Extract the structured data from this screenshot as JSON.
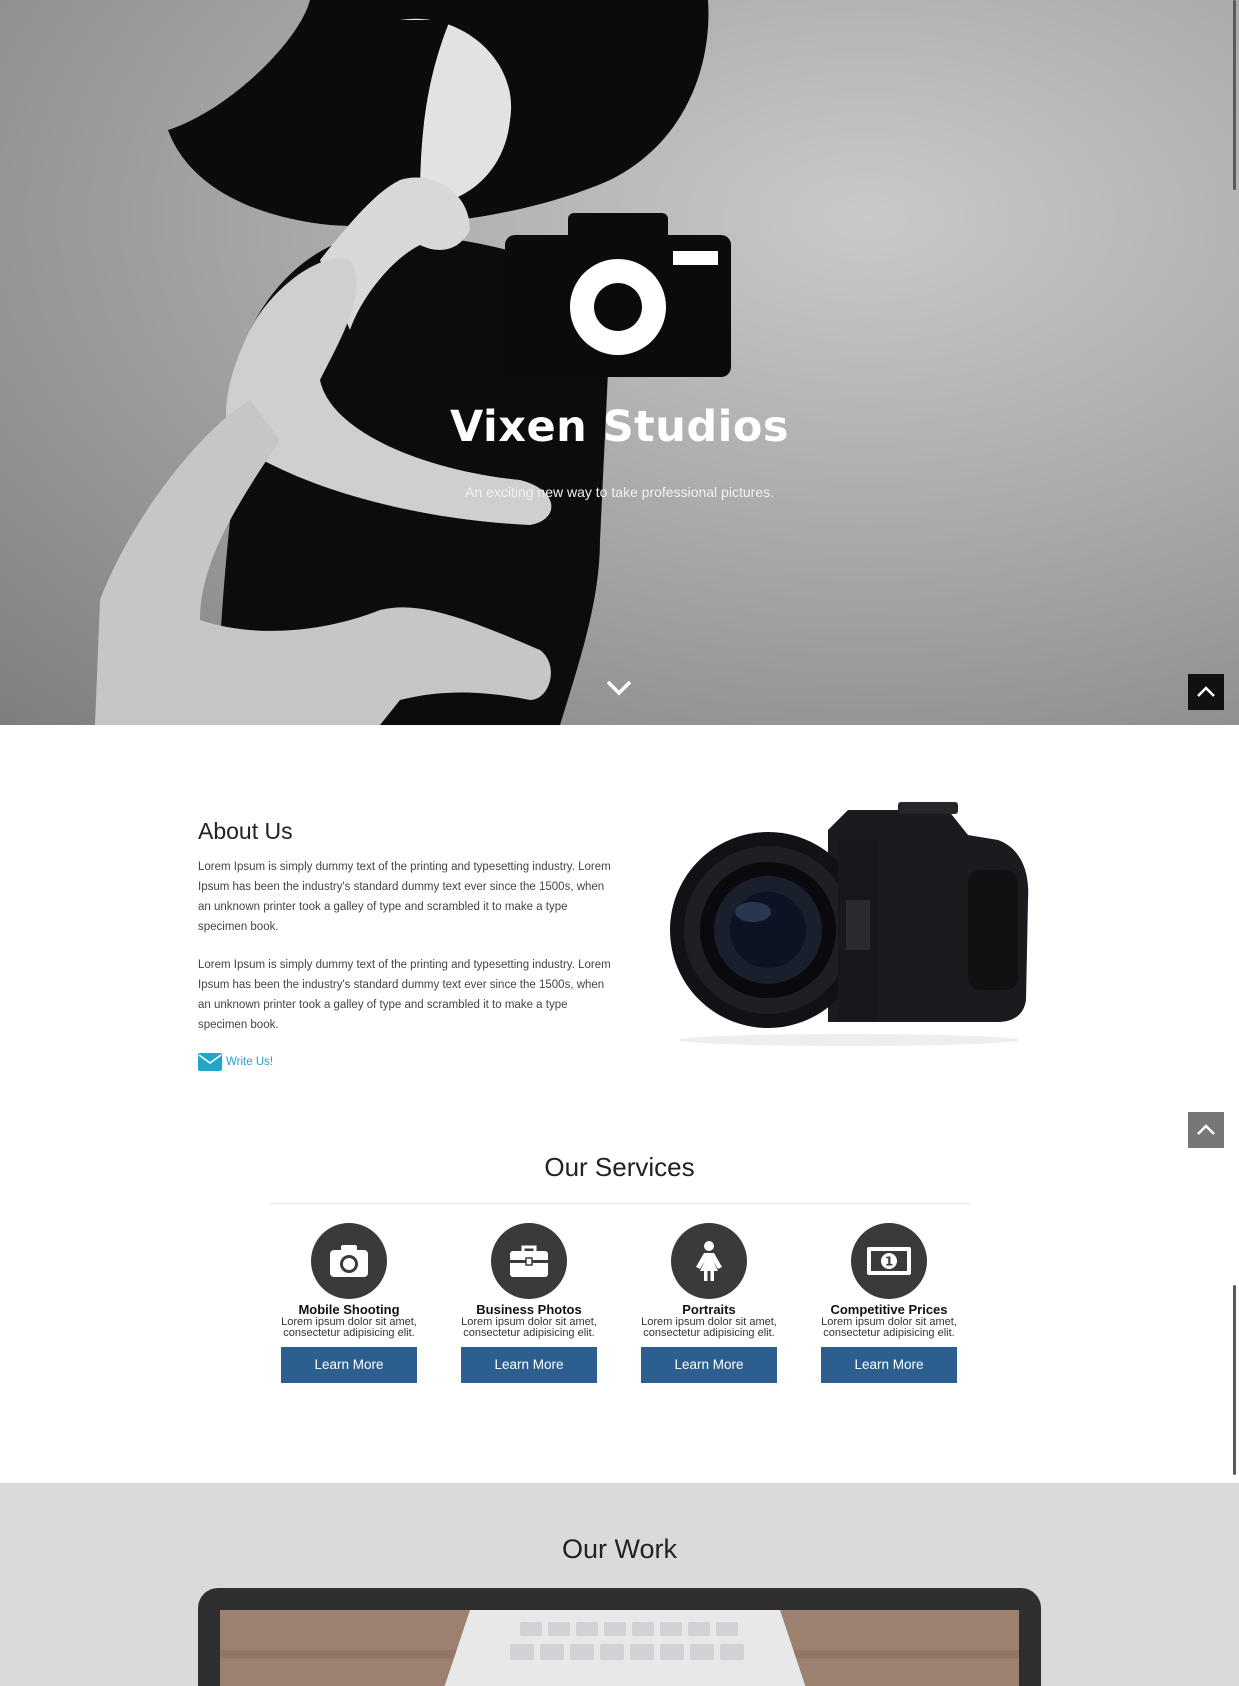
{
  "hero": {
    "title": "Vixen Studios",
    "tagline": "An exciting new way to take professional pictures."
  },
  "about": {
    "heading": "About Us",
    "paragraphs": [
      "Lorem Ipsum is simply dummy text of the printing and typesetting industry. Lorem Ipsum has been the industry's standard dummy text ever since the 1500s, when an unknown printer took a galley of type and scrambled it to make a type specimen book.",
      "Lorem Ipsum is simply dummy text of the printing and typesetting industry. Lorem Ipsum has been the industry's standard dummy text ever since the 1500s, when an unknown printer took a galley of type and scrambled it to make a type specimen book."
    ],
    "write_us": "Write Us!"
  },
  "services": {
    "title": "Our Services",
    "items": [
      {
        "icon": "camera-icon",
        "title": "Mobile Shooting",
        "line1": "Lorem ipsum dolor sit amet,",
        "line2": "consectetur adipisicing elit.",
        "button": "Learn More"
      },
      {
        "icon": "briefcase-icon",
        "title": "Business Photos",
        "line1": "Lorem ipsum dolor sit amet,",
        "line2": "consectetur adipisicing elit.",
        "button": "Learn More"
      },
      {
        "icon": "female-icon",
        "title": "Portraits",
        "line1": "Lorem ipsum dolor sit amet,",
        "line2": "consectetur adipisicing elit.",
        "button": "Learn More"
      },
      {
        "icon": "money-icon",
        "title": "Competitive Prices",
        "line1": "Lorem ipsum dolor sit amet,",
        "line2": "consectetur adipisicing elit.",
        "button": "Learn More"
      }
    ]
  },
  "work": {
    "title": "Our Work"
  },
  "colors": {
    "button_blue": "#2c5f8f",
    "link_cyan": "#20a6c8",
    "icon_circle": "#3a3a3a",
    "work_bg": "#dadada"
  }
}
